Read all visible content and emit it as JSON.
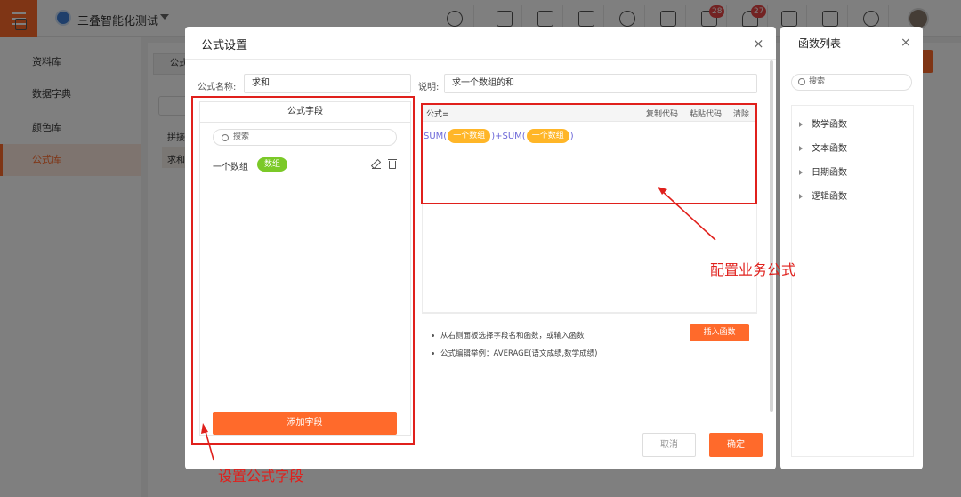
{
  "app": {
    "title": "三叠智能化测试",
    "menu_icon": "hamburger-menu-icon"
  },
  "topbar": {
    "icons": [
      "search-icon",
      "home-icon",
      "apps-grid-icon",
      "dice-icon",
      "settings-gear-icon",
      "list-icon",
      "document-icon",
      "bell-icon",
      "shirt-icon",
      "download-icon",
      "target-icon"
    ],
    "badges": {
      "document": "28",
      "bell": "27"
    }
  },
  "sidebar": {
    "header": "资料库",
    "items": [
      "数据字典",
      "颜色库",
      "公式库"
    ],
    "active_index": 2
  },
  "background": {
    "tab_label": "公式",
    "rows": [
      "拼接",
      "求和"
    ]
  },
  "dialog": {
    "title": "公式设置",
    "close": "×",
    "name_label": "公式名称:",
    "name_value": "求和",
    "desc_label": "说明:",
    "desc_value": "求一个数组的和",
    "fields_panel": {
      "header": "公式字段",
      "search_placeholder": "搜索",
      "fields": [
        {
          "name": "一个数组",
          "type": "数组"
        }
      ],
      "add_button": "添加字段"
    },
    "formula_editor": {
      "label": "公式=",
      "copy": "复制代码",
      "paste": "粘贴代码",
      "clear": "清除",
      "expr": {
        "fn1": "SUM(",
        "arg1": "一个数组",
        "close1": ")",
        "plus": "+",
        "fn2": "SUM(",
        "arg2": "一个数组",
        "close2": ")"
      }
    },
    "tips": [
      "从右侧面板选择字段名和函数，或输入函数",
      "公式编辑举例：AVERAGE(语文成绩,数学成绩)"
    ],
    "insert_function": "插入函数",
    "cancel": "取消",
    "ok": "确定"
  },
  "function_panel": {
    "title": "函数列表",
    "close": "×",
    "search_placeholder": "搜索",
    "categories": [
      "数学函数",
      "文本函数",
      "日期函数",
      "逻辑函数"
    ]
  },
  "annotations": {
    "fields": "设置公式字段",
    "formula": "配置业务公式"
  },
  "colors": {
    "accent": "#ff6a2b",
    "annotation": "#e0201c",
    "chip": "#ffb628",
    "tag": "#7bc928",
    "formula_text": "#6d68d8"
  }
}
